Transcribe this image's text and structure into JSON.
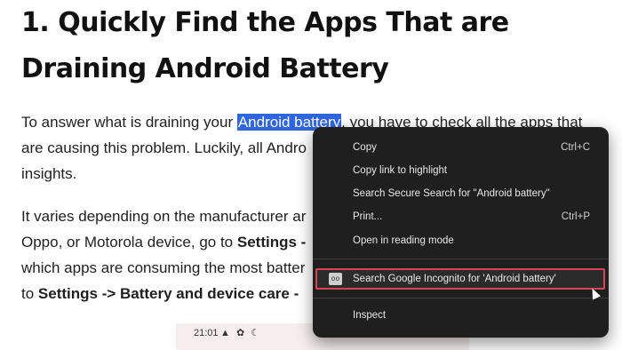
{
  "article": {
    "heading_line1": "1. Quickly Find the Apps That are",
    "heading_line2": "Draining Android Battery",
    "p1": {
      "l1_a": "To answer what is draining your ",
      "l1_highlight": "Android battery",
      "l1_b": ", you have to check all the apps that",
      "l2": "are causing this problem. Luckily, all Andro",
      "l3": "insights."
    },
    "p2": {
      "l1": "It varies depending on the manufacturer ar",
      "l2_a": "Oppo, or Motorola device, go to ",
      "l2_bold": "Settings -",
      "l3": "which apps are consuming the most batter",
      "l4_a": "to ",
      "l4_bold": "Settings -> Battery and device care -"
    }
  },
  "phone_preview": {
    "time": "21:01",
    "icons": "▲ ✿ ☾"
  },
  "context_menu": {
    "items": [
      {
        "label": "Copy",
        "shortcut": "Ctrl+C"
      },
      {
        "label": "Copy link to highlight",
        "shortcut": ""
      },
      {
        "label": "Search Secure Search for \"Android battery\"",
        "shortcut": ""
      },
      {
        "label": "Print...",
        "shortcut": "Ctrl+P"
      },
      {
        "label": "Open in reading mode",
        "shortcut": ""
      },
      {
        "label": "Search Google Incognito for 'Android battery'",
        "shortcut": "",
        "icon": "incognito-icon"
      },
      {
        "label": "Inspect",
        "shortcut": ""
      }
    ]
  },
  "colors": {
    "selection": "#2f66e0",
    "menu_bg": "#1f1f1f",
    "focus_outline": "#d64557"
  }
}
